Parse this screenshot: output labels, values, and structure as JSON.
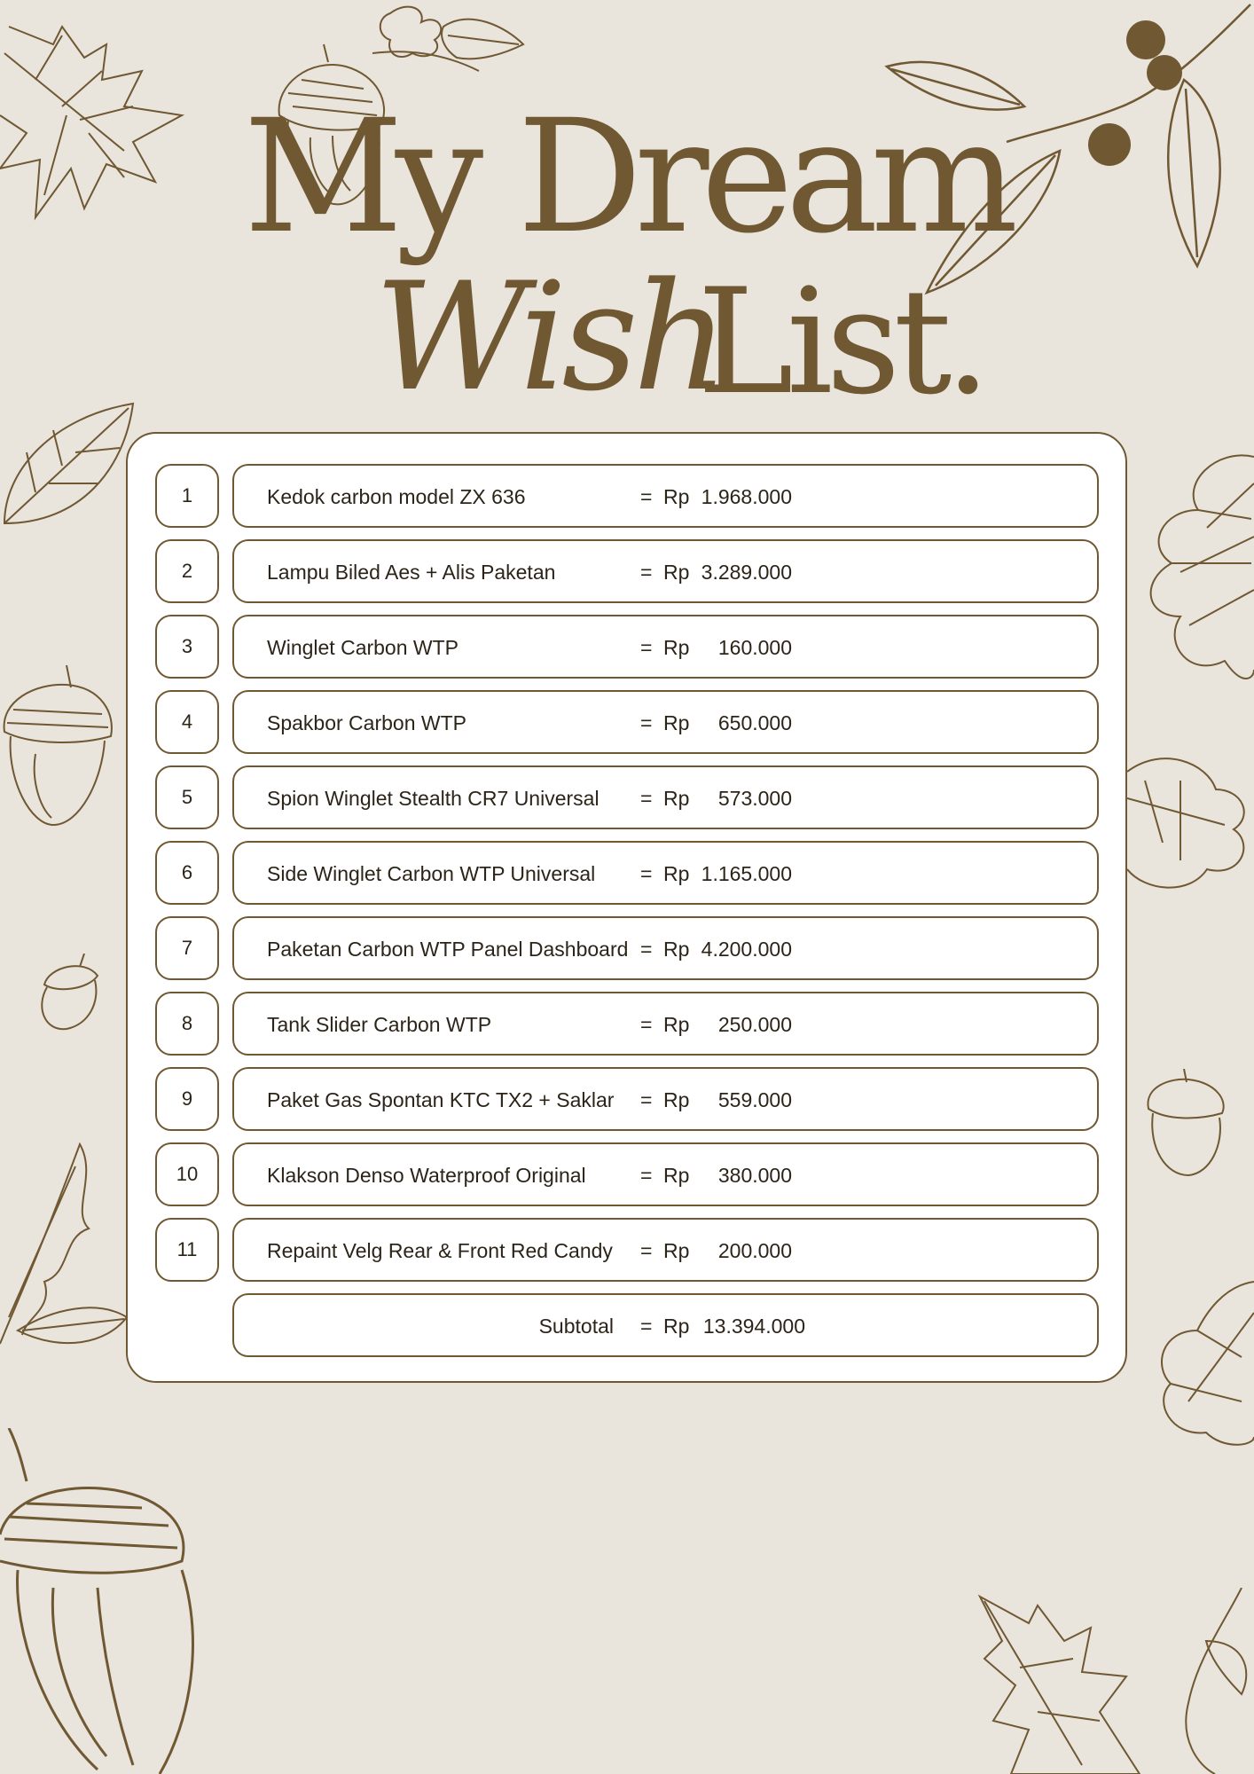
{
  "title": {
    "line1": "My Dream",
    "line2_script": "Wish",
    "line2_serif": "List."
  },
  "items": [
    {
      "num": "1",
      "name": "Kedok carbon model ZX 636",
      "eq": "=",
      "currency": "Rp",
      "amount": "1.968.000"
    },
    {
      "num": "2",
      "name": "Lampu Biled Aes + Alis Paketan",
      "eq": "=",
      "currency": "Rp",
      "amount": "3.289.000"
    },
    {
      "num": "3",
      "name": "Winglet Carbon WTP",
      "eq": "=",
      "currency": "Rp",
      "amount": "160.000"
    },
    {
      "num": "4",
      "name": "Spakbor Carbon  WTP",
      "eq": "=",
      "currency": "Rp",
      "amount": "650.000"
    },
    {
      "num": "5",
      "name": "Spion Winglet Stealth CR7 Universal",
      "eq": "=",
      "currency": "Rp",
      "amount": "573.000"
    },
    {
      "num": "6",
      "name": "Side Winglet Carbon WTP Universal",
      "eq": "=",
      "currency": "Rp",
      "amount": "1.165.000"
    },
    {
      "num": "7",
      "name": "Paketan Carbon WTP Panel Dashboard",
      "eq": "=",
      "currency": "Rp",
      "amount": "4.200.000"
    },
    {
      "num": "8",
      "name": "Tank Slider Carbon WTP",
      "eq": "=",
      "currency": "Rp",
      "amount": "250.000"
    },
    {
      "num": "9",
      "name": "Paket Gas Spontan KTC TX2 + Saklar",
      "eq": "=",
      "currency": "Rp",
      "amount": "559.000"
    },
    {
      "num": "10",
      "name": "Klakson Denso Waterproof Original",
      "eq": "=",
      "currency": "Rp",
      "amount": "380.000"
    },
    {
      "num": "11",
      "name": "Repaint Velg Rear & Front Red Candy",
      "eq": "=",
      "currency": "Rp",
      "amount": "200.000"
    }
  ],
  "subtotal": {
    "label": "Subtotal",
    "eq": "=",
    "currency": "Rp",
    "amount": "13.394.000"
  },
  "colors": {
    "background": "#e9e4dc",
    "accent": "#6f5832",
    "card": "#ffffff",
    "text": "#2c2418"
  },
  "decorations": [
    "oak-leaf-icon",
    "acorn-icon",
    "berry-branch-icon",
    "maple-leaf-icon"
  ]
}
